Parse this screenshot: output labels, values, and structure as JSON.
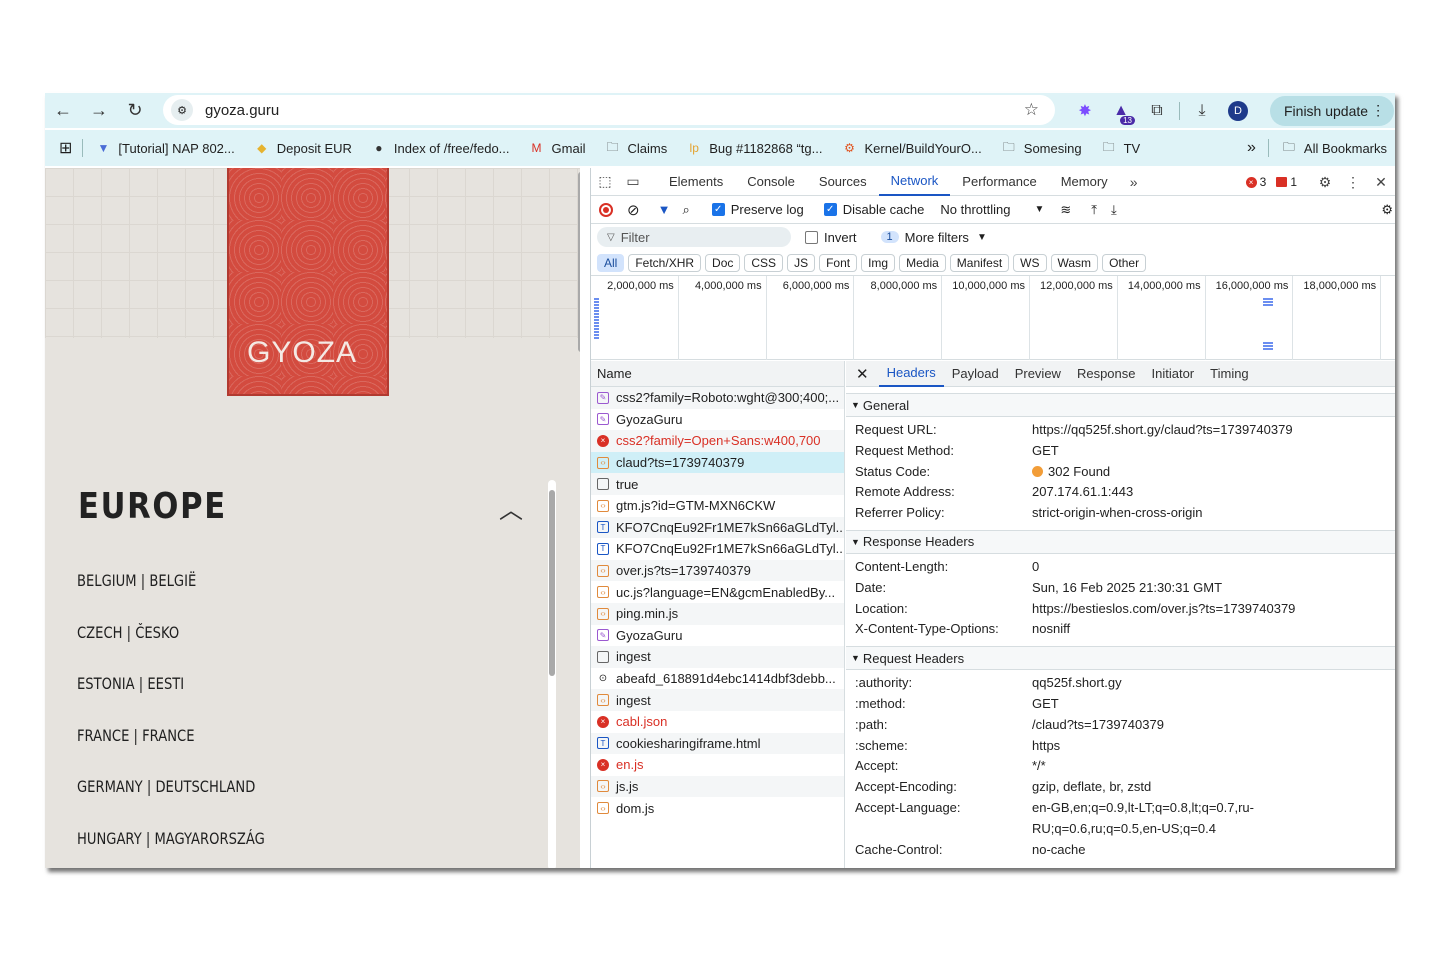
{
  "browser": {
    "url": "gyoza.guru",
    "finish_label": "Finish update",
    "avatar": "D",
    "ext_badge": "13",
    "bookmarks": [
      {
        "label": "[Tutorial] NAP 802...",
        "icon": "tutorial-icon"
      },
      {
        "label": "Deposit EUR",
        "icon": "diamond-icon"
      },
      {
        "label": "Index of /free/fedo...",
        "icon": "globe-icon"
      },
      {
        "label": "Gmail",
        "icon": "gmail-icon"
      },
      {
        "label": "Claims",
        "icon": "folder-icon"
      },
      {
        "label": "Bug #1182868 “tg...",
        "icon": "lp-icon"
      },
      {
        "label": "Kernel/BuildYourO...",
        "icon": "fedora-icon"
      },
      {
        "label": "Somesing",
        "icon": "folder-icon"
      },
      {
        "label": "TV",
        "icon": "folder-icon"
      }
    ],
    "all_bookmarks": "All Bookmarks"
  },
  "page": {
    "logo_text": "GYOZA",
    "region": "EUROPE",
    "countries": [
      "BELGIUM | BELGIË",
      "CZECH | ČESKO",
      "ESTONIA | EESTI",
      "FRANCE | FRANCE",
      "GERMANY | DEUTSCHLAND",
      "HUNGARY | MAGYARORSZÁG"
    ]
  },
  "devtools": {
    "tabs": [
      "Elements",
      "Console",
      "Sources",
      "Network",
      "Performance",
      "Memory"
    ],
    "active_tab": "Network",
    "error_count": "3",
    "issue_count": "1",
    "preserve_log": "Preserve log",
    "disable_cache": "Disable cache",
    "throttling": "No throttling",
    "filter_placeholder": "Filter",
    "invert": "Invert",
    "more_filters_count": "1",
    "more_filters": "More filters",
    "type_filters": [
      "All",
      "Fetch/XHR",
      "Doc",
      "CSS",
      "JS",
      "Font",
      "Img",
      "Media",
      "Manifest",
      "WS",
      "Wasm",
      "Other"
    ],
    "timeline_ticks": [
      "2,000,000 ms",
      "4,000,000 ms",
      "6,000,000 ms",
      "8,000,000 ms",
      "10,000,000 ms",
      "12,000,000 ms",
      "14,000,000 ms",
      "16,000,000 ms",
      "18,000,000 ms"
    ],
    "name_header": "Name",
    "requests": [
      {
        "name": "css2?family=Roboto:wght@300;400;...",
        "type": "css"
      },
      {
        "name": "GyozaGuru",
        "type": "css"
      },
      {
        "name": "css2?family=Open+Sans:w400,700",
        "type": "error"
      },
      {
        "name": "claud?ts=1739740379",
        "type": "js",
        "selected": true
      },
      {
        "name": "true",
        "type": "doc"
      },
      {
        "name": "gtm.js?id=GTM-MXN6CKW",
        "type": "js"
      },
      {
        "name": "KFO7CnqEu92Fr1ME7kSn66aGLdTyl...",
        "type": "font"
      },
      {
        "name": "KFO7CnqEu92Fr1ME7kSn66aGLdTyl...",
        "type": "font"
      },
      {
        "name": "over.js?ts=1739740379",
        "type": "js"
      },
      {
        "name": "uc.js?language=EN&gcmEnabledBy...",
        "type": "js"
      },
      {
        "name": "ping.min.js",
        "type": "js"
      },
      {
        "name": "GyozaGuru",
        "type": "css"
      },
      {
        "name": "ingest",
        "type": "doc"
      },
      {
        "name": "abeafd_618891d4ebc1414dbf3debb...",
        "type": "other"
      },
      {
        "name": "ingest",
        "type": "js"
      },
      {
        "name": "cabl.json",
        "type": "error"
      },
      {
        "name": "cookiesharingiframe.html",
        "type": "font"
      },
      {
        "name": "en.js",
        "type": "error"
      },
      {
        "name": "js.js",
        "type": "js"
      },
      {
        "name": "dom.js",
        "type": "js"
      }
    ],
    "detail_tabs": [
      "Headers",
      "Payload",
      "Preview",
      "Response",
      "Initiator",
      "Timing"
    ],
    "active_detail_tab": "Headers",
    "general_title": "General",
    "general": [
      {
        "k": "Request URL:",
        "v": "https://qq525f.short.gy/claud?ts=1739740379"
      },
      {
        "k": "Request Method:",
        "v": "GET"
      },
      {
        "k": "Status Code:",
        "v": "302 Found",
        "status": true
      },
      {
        "k": "Remote Address:",
        "v": "207.174.61.1:443"
      },
      {
        "k": "Referrer Policy:",
        "v": "strict-origin-when-cross-origin"
      }
    ],
    "response_title": "Response Headers",
    "response_headers": [
      {
        "k": "Content-Length:",
        "v": "0"
      },
      {
        "k": "Date:",
        "v": "Sun, 16 Feb 2025 21:30:31 GMT"
      },
      {
        "k": "Location:",
        "v": "https://bestieslos.com/over.js?ts=1739740379"
      },
      {
        "k": "X-Content-Type-Options:",
        "v": "nosniff"
      }
    ],
    "request_title": "Request Headers",
    "request_headers": [
      {
        "k": ":authority:",
        "v": "qq525f.short.gy"
      },
      {
        "k": ":method:",
        "v": "GET"
      },
      {
        "k": ":path:",
        "v": "/claud?ts=1739740379"
      },
      {
        "k": ":scheme:",
        "v": "https"
      },
      {
        "k": "Accept:",
        "v": "*/*"
      },
      {
        "k": "Accept-Encoding:",
        "v": "gzip, deflate, br, zstd"
      },
      {
        "k": "Accept-Language:",
        "v": "en-GB,en;q=0.9,lt-LT;q=0.8,lt;q=0.7,ru-RU;q=0.6,ru;q=0.5,en-US;q=0.4"
      },
      {
        "k": "Cache-Control:",
        "v": "no-cache"
      }
    ],
    "accent": "#1a56c4",
    "error_color": "#d93025"
  }
}
